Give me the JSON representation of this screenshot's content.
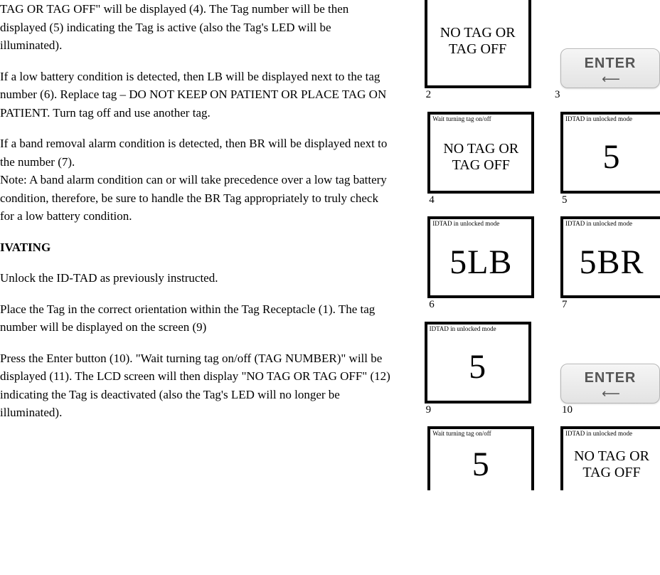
{
  "paragraphs": {
    "p1": "TAG OR TAG OFF\" will be displayed (4). The Tag number will be then displayed (5) indicating the Tag is active (also the Tag's LED will be illuminated).",
    "p2": "If a low battery condition is detected, then LB will be displayed next to the tag number (6). Replace tag – DO NOT KEEP ON PATIENT OR PLACE TAG ON PATIENT. Turn tag off and use another tag.",
    "p3": "If a band removal alarm condition is detected, then BR will be displayed next to the number (7).",
    "p4": "Note: A band alarm condition can or will take precedence over a low tag battery condition, therefore, be sure to handle the BR Tag appropriately to truly check for a low battery condition.",
    "heading": "IVATING",
    "p5": "Unlock the ID-TAD as previously instructed.",
    "p6": "Place the Tag in the correct orientation within the Tag Receptacle (1). The tag number will be displayed on the screen (9)",
    "p7": "Press the Enter button (10). \"Wait turning tag on/off (TAG NUMBER)\" will be displayed (11). The LCD screen will then display \"NO TAG OR TAG OFF\" (12) indicating the Tag is deactivated (also the Tag's LED will no longer be illuminated)."
  },
  "diagram": {
    "caption_unlocked": "IDTAD in unlocked mode",
    "caption_wait": "Wait turning tag on/off",
    "no_tag": "NO TAG OR TAG OFF",
    "five": "5",
    "five_lb": "5LB",
    "five_br": "5BR",
    "enter": "ENTER",
    "n2": "2",
    "n3": "3",
    "n4": "4",
    "n5": "5",
    "n6": "6",
    "n7": "7",
    "n9": "9",
    "n10": "10"
  }
}
